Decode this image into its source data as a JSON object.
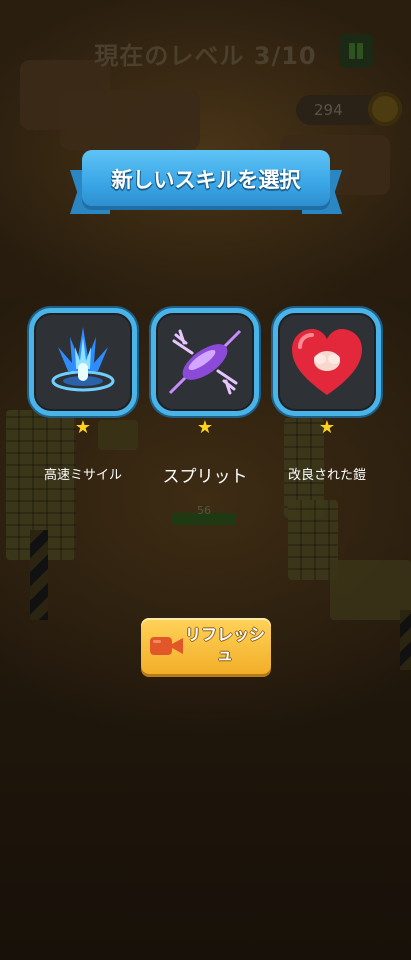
{
  "hud": {
    "level_text": "現在のレベル 3/10",
    "coins": "294",
    "pause_icon": "pause-icon",
    "coin_icon": "coin-icon",
    "player_hp": "56"
  },
  "dialog": {
    "title": "新しいスキルを選択",
    "skills": [
      {
        "name": "高速ミサイル",
        "icon": "blue-missile-burst-icon",
        "stars": 1
      },
      {
        "name": "スプリット",
        "icon": "purple-split-missile-icon",
        "stars": 1
      },
      {
        "name": "改良された鎧",
        "icon": "heart-armor-icon",
        "stars": 1
      }
    ],
    "refresh_label": "リフレッシュ",
    "refresh_icon": "video-camera-icon",
    "star_glyph": "★"
  },
  "colors": {
    "accent_blue": "#4ab3e8",
    "star_yellow": "#ffd21f",
    "button_orange": "#f2ae28"
  }
}
